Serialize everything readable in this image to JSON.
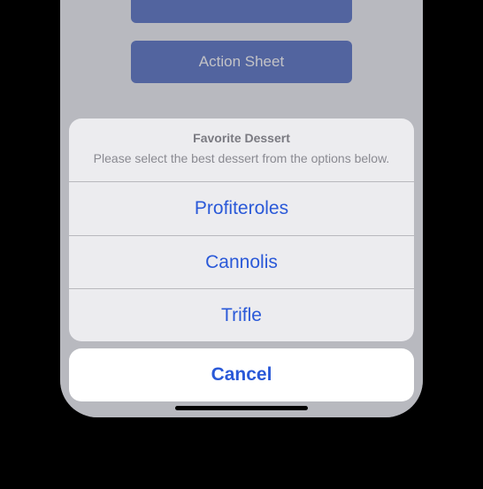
{
  "background_buttons": [
    "",
    "Action Sheet"
  ],
  "action_sheet": {
    "title": "Favorite Dessert",
    "message": "Please select the best dessert from the options below.",
    "options": [
      "Profiteroles",
      "Cannolis",
      "Trifle"
    ],
    "cancel_label": "Cancel"
  },
  "colors": {
    "tint": "#2a59d8",
    "button_bg": "#2a4bb5"
  }
}
